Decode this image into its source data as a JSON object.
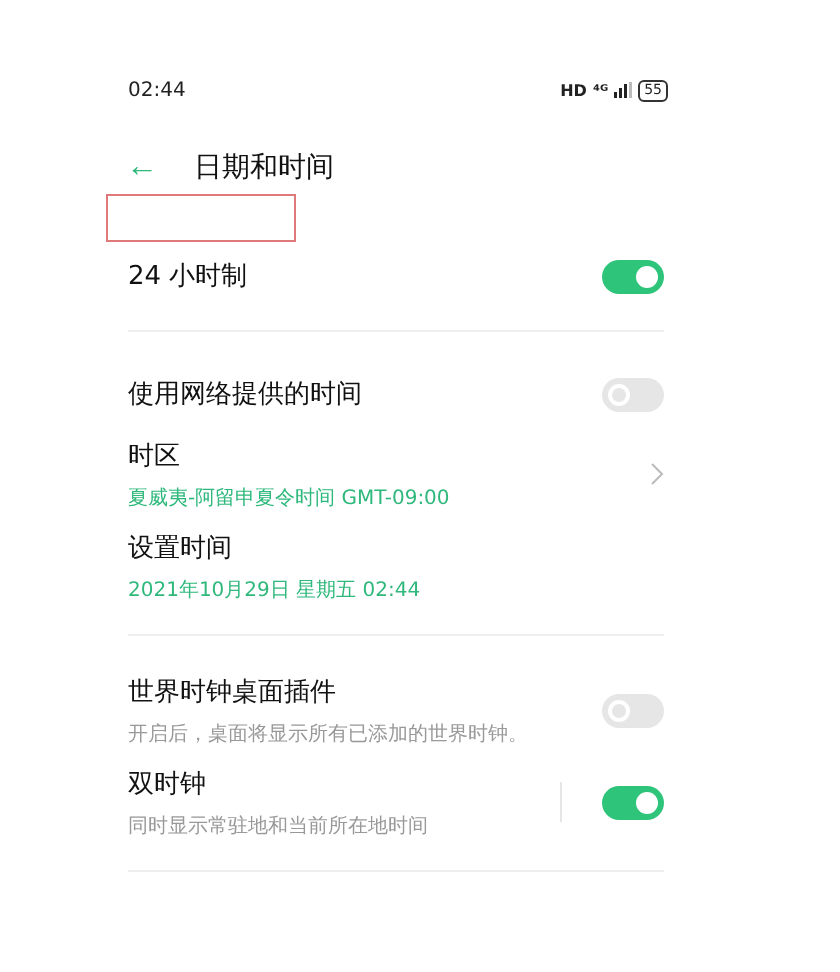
{
  "status_bar": {
    "time": "02:44",
    "network": "HD",
    "signal_label": "⁴ᴳ",
    "battery": "55"
  },
  "header": {
    "back": "←",
    "title": "日期和时间"
  },
  "groups": [
    {
      "items": [
        {
          "kind": "toggle",
          "title": "24 小时制",
          "on": true,
          "divider": false
        }
      ]
    },
    {
      "items": [
        {
          "kind": "toggle",
          "title": "使用网络提供的时间",
          "on": false,
          "divider": false
        },
        {
          "kind": "link",
          "title": "时区",
          "subtitle": "夏威夷-阿留申夏令时间 GMT-09:00"
        },
        {
          "kind": "plain",
          "title": "设置时间",
          "subtitle": "2021年10月29日 星期五  02:44"
        }
      ]
    },
    {
      "items": [
        {
          "kind": "toggle",
          "title": "世界时钟桌面插件",
          "subtitle": "开启后，桌面将显示所有已添加的世界时钟。",
          "on": false,
          "divider": false
        },
        {
          "kind": "toggle",
          "title": "双时钟",
          "subtitle": "同时显示常驻地和当前所在地时间",
          "on": true,
          "divider": true
        }
      ]
    }
  ]
}
